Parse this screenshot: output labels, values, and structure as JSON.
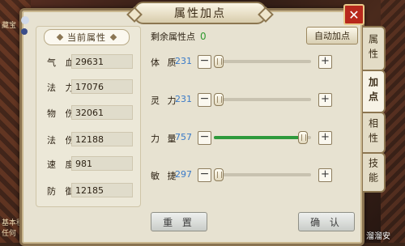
{
  "window": {
    "title": "属性加点",
    "close_icon": "close-icon"
  },
  "current_attributes": {
    "title": "当前属性",
    "stats": [
      {
        "label": "气 血",
        "value": "29631"
      },
      {
        "label": "法 力",
        "value": "17076"
      },
      {
        "label": "物 伤",
        "value": "32061"
      },
      {
        "label": "法 伤",
        "value": "12188"
      },
      {
        "label": "速 度",
        "value": "981"
      },
      {
        "label": "防 御",
        "value": "12185"
      }
    ]
  },
  "allocation": {
    "remaining_label": "剩余属性点",
    "remaining_value": "0",
    "auto_button": "自动加点",
    "attributes": [
      {
        "label": "体 质",
        "value": "231",
        "level": 0.0
      },
      {
        "label": "灵 力",
        "value": "231",
        "level": 0.0
      },
      {
        "label": "力 量",
        "value": "757",
        "level": 0.96
      },
      {
        "label": "敏 捷",
        "value": "297",
        "level": 0.0
      }
    ]
  },
  "buttons": {
    "reset": "重 置",
    "confirm": "确 认"
  },
  "side_tabs": [
    {
      "label": "属性",
      "active": false
    },
    {
      "label": "加点",
      "active": true
    },
    {
      "label": "相性",
      "active": false
    },
    {
      "label": "技能",
      "active": false
    }
  ],
  "background_text": {
    "line1": "基本移动",
    "line2": "任何",
    "line3": "藏宝"
  },
  "watermark": "溜溜安",
  "colors": {
    "remaining": "#2f9a2f",
    "attr_value": "#3a7ac8",
    "slider_fill": "#2e9a3c",
    "close": "#b8281c"
  }
}
